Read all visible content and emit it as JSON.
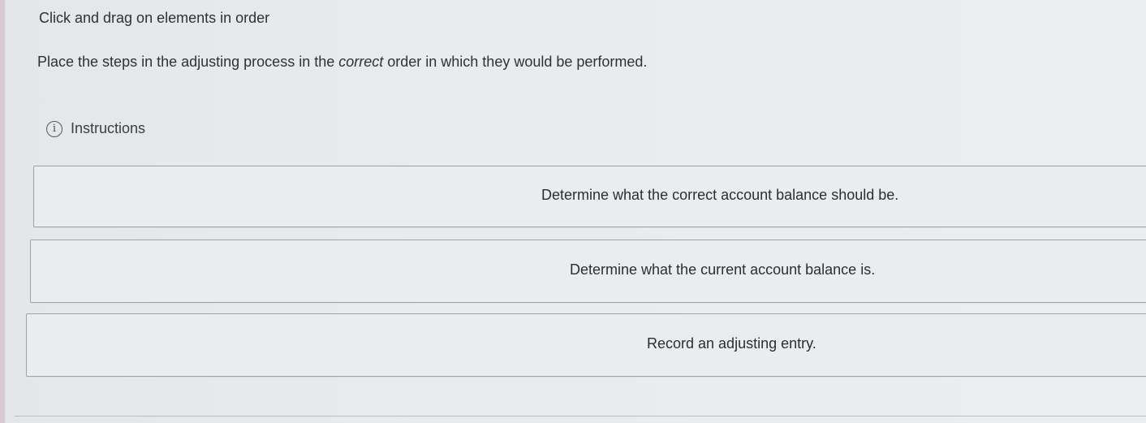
{
  "header": {
    "title": "Click and drag on elements in order"
  },
  "prompt": {
    "before": "Place the steps in the adjusting process in the ",
    "emphasis": "correct",
    "after": " order in which they would be performed."
  },
  "instructions": {
    "icon": "info-icon",
    "icon_glyph": "i",
    "label": "Instructions"
  },
  "steps": [
    {
      "label": "Determine what the correct account balance should be."
    },
    {
      "label": "Determine what the current account balance is."
    },
    {
      "label": "Record an adjusting entry."
    }
  ]
}
